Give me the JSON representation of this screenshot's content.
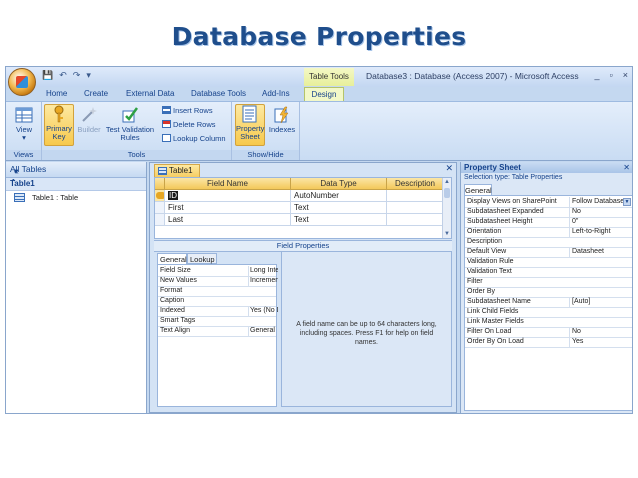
{
  "slide": {
    "title": "Database Properties"
  },
  "window": {
    "title": "Database3 : Database (Access 2007) - Microsoft Access",
    "context_tab": "Table Tools",
    "controls": [
      "_",
      "▫",
      "×"
    ]
  },
  "ribbon_tabs": [
    "Home",
    "Create",
    "External Data",
    "Database Tools",
    "Add-Ins",
    "Design"
  ],
  "ribbon": {
    "views": {
      "label": "Views",
      "view_button": "View"
    },
    "tools": {
      "label": "Tools",
      "primary_key": "Primary Key",
      "builder": "Builder",
      "test_validation": "Test Validation Rules",
      "insert_rows": "Insert Rows",
      "delete_rows": "Delete Rows",
      "lookup_column": "Lookup Column"
    },
    "show_hide": {
      "label": "Show/Hide",
      "property_sheet": "Property Sheet",
      "indexes": "Indexes"
    }
  },
  "nav": {
    "header": "All Tables",
    "group": "Table1",
    "items": [
      "Table1 : Table"
    ]
  },
  "design": {
    "tab": "Table1",
    "columns": [
      "Field Name",
      "Data Type",
      "Description"
    ],
    "rows": [
      {
        "name": "ID",
        "type": "AutoNumber",
        "desc": ""
      },
      {
        "name": "First",
        "type": "Text",
        "desc": ""
      },
      {
        "name": "Last",
        "type": "Text",
        "desc": ""
      }
    ],
    "field_properties_label": "Field Properties",
    "fp_tabs": [
      "General",
      "Lookup"
    ],
    "fp_rows": [
      {
        "name": "Field Size",
        "value": "Long Integer"
      },
      {
        "name": "New Values",
        "value": "Increment"
      },
      {
        "name": "Format",
        "value": ""
      },
      {
        "name": "Caption",
        "value": ""
      },
      {
        "name": "Indexed",
        "value": "Yes (No Duplicates)"
      },
      {
        "name": "Smart Tags",
        "value": ""
      },
      {
        "name": "Text Align",
        "value": "General"
      }
    ],
    "help_text": "A field name can be up to 64 characters long, including spaces. Press F1 for help on field names."
  },
  "property_sheet": {
    "title": "Property Sheet",
    "selection_type": "Selection type: Table Properties",
    "tab": "General",
    "rows": [
      {
        "name": "Display Views on SharePoint",
        "value": "Follow Database",
        "dropdown": true
      },
      {
        "name": "Subdatasheet Expanded",
        "value": "No"
      },
      {
        "name": "Subdatasheet Height",
        "value": "0\""
      },
      {
        "name": "Orientation",
        "value": "Left-to-Right"
      },
      {
        "name": "Description",
        "value": ""
      },
      {
        "name": "Default View",
        "value": "Datasheet"
      },
      {
        "name": "Validation Rule",
        "value": ""
      },
      {
        "name": "Validation Text",
        "value": ""
      },
      {
        "name": "Filter",
        "value": ""
      },
      {
        "name": "Order By",
        "value": ""
      },
      {
        "name": "Subdatasheet Name",
        "value": "[Auto]"
      },
      {
        "name": "Link Child Fields",
        "value": ""
      },
      {
        "name": "Link Master Fields",
        "value": ""
      },
      {
        "name": "Filter On Load",
        "value": "No"
      },
      {
        "name": "Order By On Load",
        "value": "Yes"
      }
    ]
  }
}
